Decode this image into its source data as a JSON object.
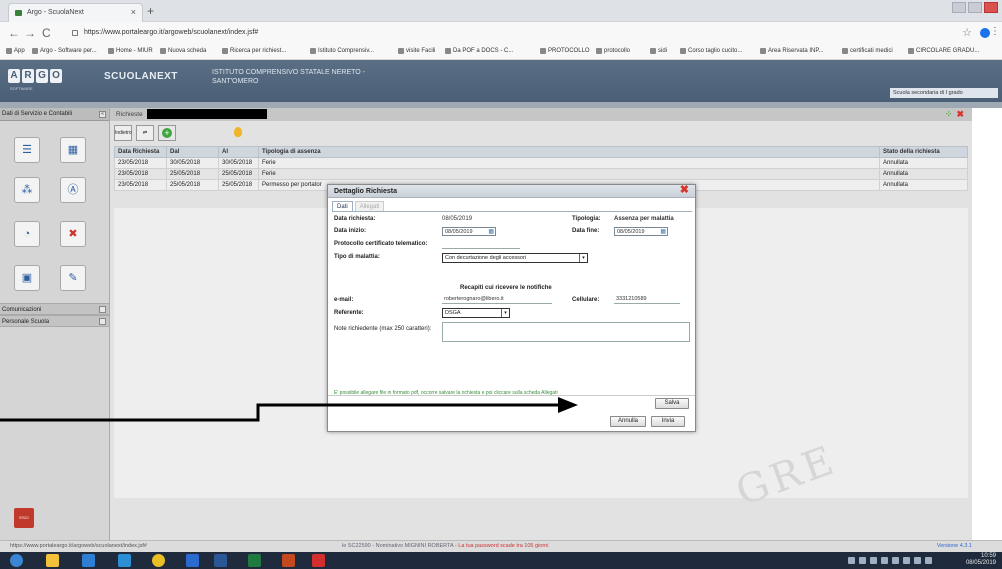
{
  "browser": {
    "tab_title": "Argo - ScuolaNext",
    "new_tab": "+",
    "back": "←",
    "forward": "→",
    "reload": "C",
    "url": "https://www.portaleargo.it/argoweb/scuolanext/index.jsf#",
    "bookmarks": [
      "App",
      "Argo - Software per...",
      "Home - MIUR",
      "Nuova scheda",
      "Ricerca per richiest...",
      "Istituto Comprensiv...",
      "visite Facili",
      "Da POF a DOCS - C...",
      "PROTOCOLLO",
      "protocollo",
      "sidi",
      "Corso taglio cucito...",
      "Area Riservata INP...",
      "certificati medici",
      "CIRCOLARE GRADU..."
    ]
  },
  "app": {
    "logo_letters": [
      "A",
      "R",
      "G",
      "O"
    ],
    "logo_sub": "SOFTWARE",
    "name": "SCUOLANEXT",
    "school_line1": "ISTITUTO COMPRENSIVO STATALE NERETO -",
    "school_line2": "SANT'OMERO",
    "school_select": "Scuola secondaria di I grado"
  },
  "sidebar": {
    "header": "Dati di Servizio e Contabili",
    "sections": [
      "Comunicazioni",
      "Personale Scuola"
    ],
    "logout": "ESCI"
  },
  "main": {
    "title": "Richieste",
    "toolbar_label": "Indietro",
    "columns": [
      "Data Richiesta",
      "Dal",
      "Al",
      "Tipologia di assenza",
      "Stato della richiesta"
    ],
    "rows": [
      {
        "data": "23/05/2018",
        "dal": "30/05/2018",
        "al": "30/05/2018",
        "tipo": "Ferie",
        "stato": "Annullata"
      },
      {
        "data": "23/05/2018",
        "dal": "25/05/2018",
        "al": "25/05/2018",
        "tipo": "Ferie",
        "stato": "Annullata"
      },
      {
        "data": "23/05/2018",
        "dal": "25/05/2018",
        "al": "25/05/2018",
        "tipo": "Permesso per portator",
        "stato": "Annullata"
      }
    ]
  },
  "dialog": {
    "title": "Dettaglio Richiesta",
    "tabs": [
      "Dati",
      "Allegati"
    ],
    "data_richiesta_label": "Data richiesta:",
    "data_richiesta_value": "08/05/2019",
    "tipologia_label": "Tipologia:",
    "tipologia_value": "Assenza per malattia",
    "data_inizio_label": "Data inizio:",
    "data_inizio_value": "08/05/2019",
    "data_fine_label": "Data fine:",
    "data_fine_value": "08/05/2019",
    "protocollo_label": "Protocollo certificato telematico:",
    "tipo_malattia_label": "Tipo di malattia:",
    "tipo_malattia_value": "Con decurtazione degli accessori",
    "recapiti_heading": "Recapiti cui ricevere le notifiche",
    "email_label": "e-mail:",
    "email_value": "roberterognaro@libero.it",
    "cellulare_label": "Cellulare:",
    "cellulare_value": "3331210589",
    "referente_label": "Referente:",
    "referente_value": "DSGA",
    "note_label": "Note richiedente (max 250 caratteri):",
    "hint": "E' possibile allegare file in formato pdf, occorre salvare la richiesta e poi cliccare sulla scheda Allegati",
    "salva": "Salva",
    "annulla": "Annulla",
    "invia": "Invia"
  },
  "status": {
    "url": "https://www.portaleargo.it/argoweb/scuolanext/index.jsf#",
    "message_prefix": "le SC22590 - Nominativo MIGNINI ROBERTA",
    "message_warn": "- La tua password scade tra 105 giorni",
    "version": "Versione 4.3.1"
  },
  "taskbar": {
    "time": "10:59",
    "date": "08/05/2019"
  },
  "colors": {
    "header": "#4a5f76",
    "hint_green": "#3a8d3a",
    "close_red": "#d9342b"
  }
}
